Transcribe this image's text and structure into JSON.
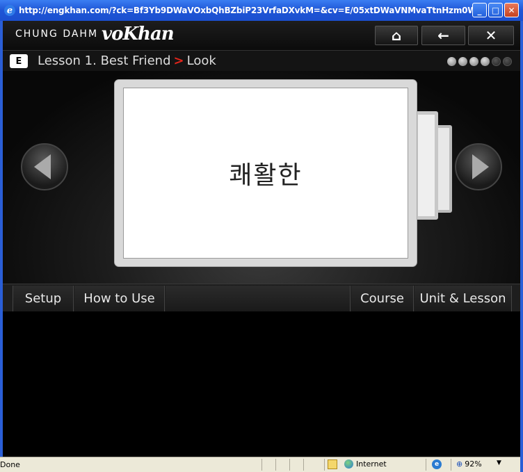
{
  "window": {
    "title": "http://engkhan.com/?ck=Bf3Yb9DWaVOxbQhBZbiP23VrfaDXvkM=&cv=E/05xtDWaVNMvaTtnHzm0WBH...",
    "minimize": "_",
    "maximize": "□",
    "close": "✕"
  },
  "header": {
    "brand": "CHUNG DAHM",
    "logo": "voKhan",
    "home_icon": "⌂",
    "back_icon": "←",
    "close_icon": "✕"
  },
  "breadcrumb": {
    "badge": "E",
    "lesson": "Lesson 1. Best Friend",
    "separator": ">",
    "section": "Look",
    "progress_total": 6,
    "progress_filled": 4
  },
  "card": {
    "word": "쾌활한"
  },
  "bottom_nav": {
    "setup": "Setup",
    "how_to_use": "How to Use",
    "course": "Course",
    "unit_lesson": "Unit & Lesson"
  },
  "status": {
    "done": "Done",
    "zone": "Internet",
    "zoom": "92%"
  }
}
